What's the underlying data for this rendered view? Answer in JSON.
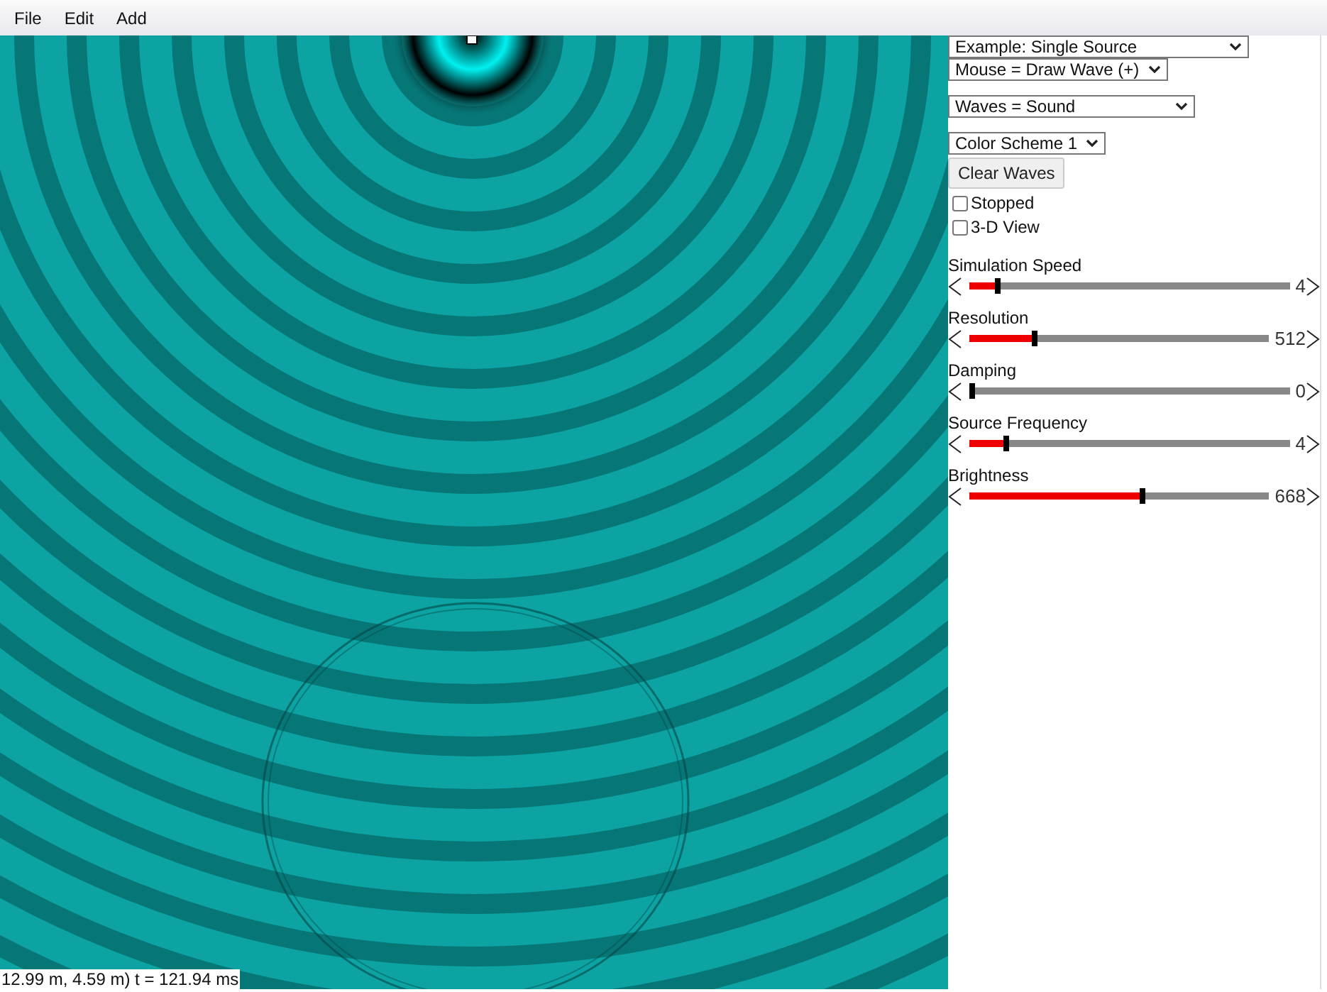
{
  "menu": [
    {
      "label": "File"
    },
    {
      "label": "Edit"
    },
    {
      "label": "Add"
    }
  ],
  "selects": [
    {
      "value": "Example: Single Source"
    },
    {
      "value": "Mouse = Draw Wave (+)"
    },
    {
      "value": "Waves = Sound"
    },
    {
      "value": "Color Scheme 1"
    }
  ],
  "button": "Clear Waves",
  "checkboxes": [
    {
      "label": "Stopped",
      "checked": false
    },
    {
      "label": "3-D View",
      "checked": false
    }
  ],
  "sliders": [
    {
      "label": "Simulation Speed",
      "level": 0.08,
      "reading": "4"
    },
    {
      "label": "Resolution",
      "level": 0.21,
      "reading": "512"
    },
    {
      "label": "Damping",
      "level": 0,
      "reading": "0"
    },
    {
      "label": "Source Frequency",
      "level": 0.11,
      "reading": "4"
    },
    {
      "label": "Brightness",
      "level": 0.58,
      "reading": "668"
    }
  ],
  "status": "12.99 m, 4.59 m) t = 121.94 ms"
}
